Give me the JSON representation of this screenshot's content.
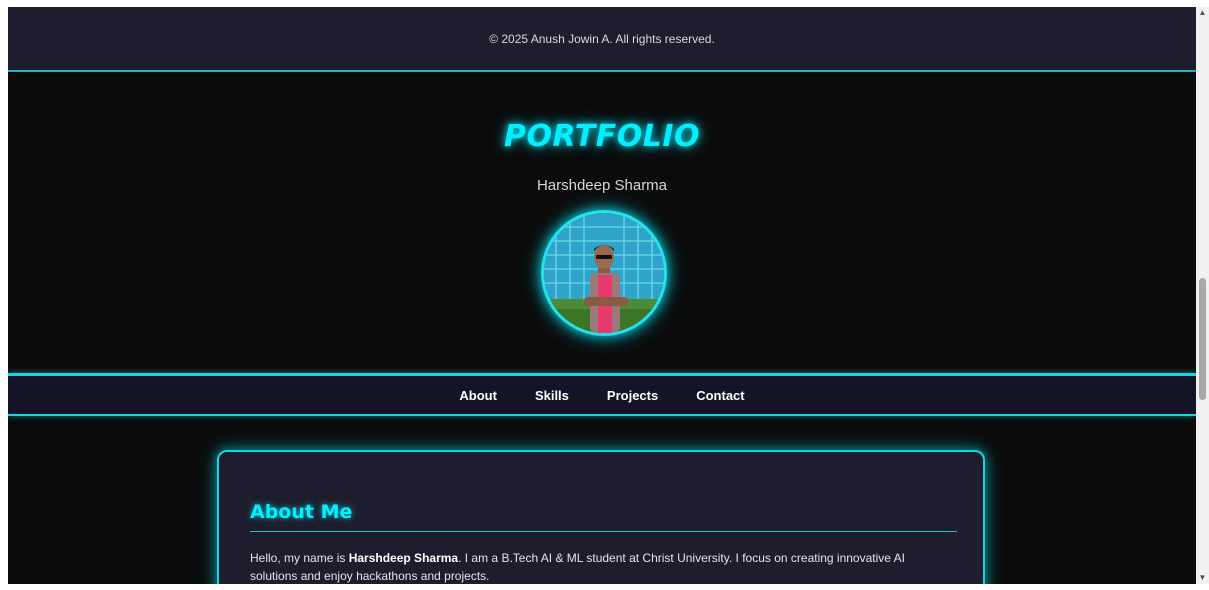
{
  "footer": {
    "copyright": "© 2025 Anush Jowin A. All rights reserved."
  },
  "hero": {
    "title": "PORTFOLIO",
    "name": "Harshdeep Sharma",
    "avatar_alt": "profile photo"
  },
  "nav": {
    "items": [
      {
        "label": "About"
      },
      {
        "label": "Skills"
      },
      {
        "label": "Projects"
      },
      {
        "label": "Contact"
      }
    ]
  },
  "about": {
    "title": "About Me",
    "intro": "Hello, my name is ",
    "name_bold": "Harshdeep Sharma",
    "text": ". I am a B.Tech AI & ML student at Christ University. I focus on creating innovative AI solutions and enjoy hackathons and projects."
  },
  "scrollbar": {
    "up_icon": "▲",
    "down_icon": "▼"
  },
  "colors": {
    "accent": "#00f0ff",
    "background": "#0b0b0b",
    "panel": "#1d1d2e",
    "nav_bg": "#141428"
  }
}
